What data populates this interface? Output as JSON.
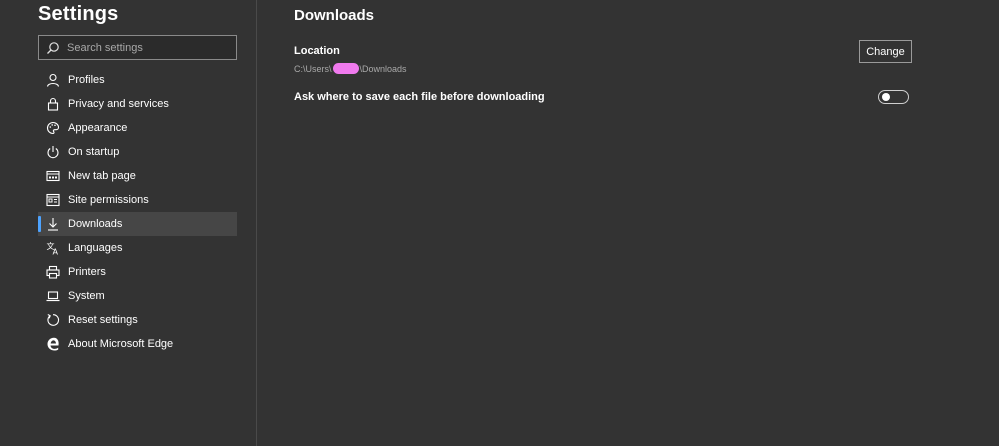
{
  "sidebar": {
    "title": "Settings",
    "search": {
      "placeholder": "Search settings",
      "value": ""
    },
    "items": [
      {
        "label": "Profiles",
        "icon": "person-icon"
      },
      {
        "label": "Privacy and services",
        "icon": "lock-icon"
      },
      {
        "label": "Appearance",
        "icon": "palette-icon"
      },
      {
        "label": "On startup",
        "icon": "power-icon"
      },
      {
        "label": "New tab page",
        "icon": "new-tab-icon"
      },
      {
        "label": "Site permissions",
        "icon": "site-permissions-icon"
      },
      {
        "label": "Downloads",
        "icon": "download-icon",
        "selected": true
      },
      {
        "label": "Languages",
        "icon": "languages-icon"
      },
      {
        "label": "Printers",
        "icon": "printer-icon"
      },
      {
        "label": "System",
        "icon": "laptop-icon"
      },
      {
        "label": "Reset settings",
        "icon": "reset-icon"
      },
      {
        "label": "About Microsoft Edge",
        "icon": "edge-logo-icon"
      }
    ]
  },
  "main": {
    "title": "Downloads",
    "location": {
      "label": "Location",
      "path_prefix": "C:\\Users\\",
      "path_suffix": "\\Downloads",
      "change_label": "Change"
    },
    "ask": {
      "label": "Ask where to save each file before downloading",
      "enabled": false
    }
  },
  "colors": {
    "background": "#333333",
    "selected_item": "#464646",
    "accent": "#4da3ff",
    "redaction": "#f07aee"
  }
}
